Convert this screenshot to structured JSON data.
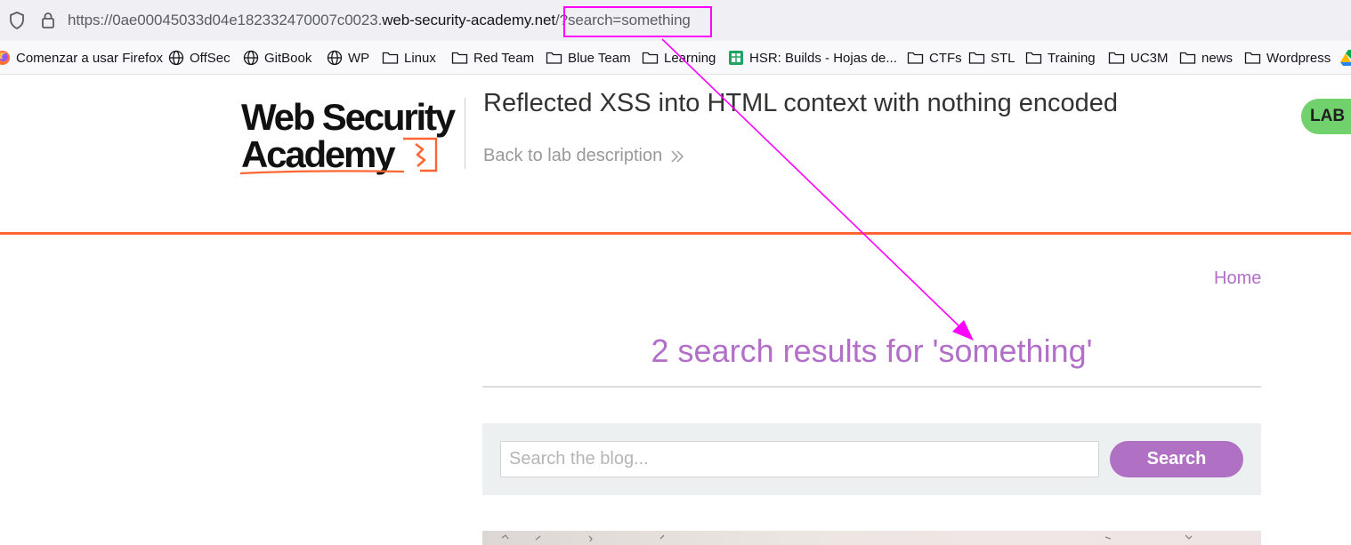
{
  "browser": {
    "url": {
      "prefix": "https://0ae00045033d04e182332470007c0023.",
      "host": "web-security-academy.net",
      "query": "/?search=something"
    },
    "bookmarks": [
      {
        "label": "Comenzar a usar Firefox",
        "icon": "firefox-icon"
      },
      {
        "label": "OffSec",
        "icon": "globe-icon"
      },
      {
        "label": "GitBook",
        "icon": "globe-icon"
      },
      {
        "label": "WP",
        "icon": "globe-icon"
      },
      {
        "label": "Linux",
        "icon": "folder-icon"
      },
      {
        "label": "Red Team",
        "icon": "folder-icon"
      },
      {
        "label": "Blue Team",
        "icon": "folder-icon"
      },
      {
        "label": "Learning",
        "icon": "folder-icon"
      },
      {
        "label": "HSR: Builds - Hojas de...",
        "icon": "google-sheets-icon"
      },
      {
        "label": "CTFs",
        "icon": "folder-icon"
      },
      {
        "label": "STL",
        "icon": "folder-icon"
      },
      {
        "label": "Training",
        "icon": "folder-icon"
      },
      {
        "label": "UC3M",
        "icon": "folder-icon"
      },
      {
        "label": "news",
        "icon": "folder-icon"
      },
      {
        "label": "Wordpress",
        "icon": "folder-icon"
      }
    ]
  },
  "header": {
    "logo_line1": "Web Security",
    "logo_line2": "Academy",
    "lab_title": "Reflected XSS into HTML context with nothing encoded",
    "back_link": "Back to lab description",
    "lab_badge": "LAB"
  },
  "nav": {
    "home": "Home"
  },
  "results": {
    "heading": "2 search results for 'something'"
  },
  "search": {
    "placeholder": "Search the blog...",
    "button": "Search"
  },
  "colors": {
    "accent": "#b26fc7",
    "orange": "#ff6633",
    "lab_badge": "#70d16d",
    "annotation": "#ff00ff"
  }
}
